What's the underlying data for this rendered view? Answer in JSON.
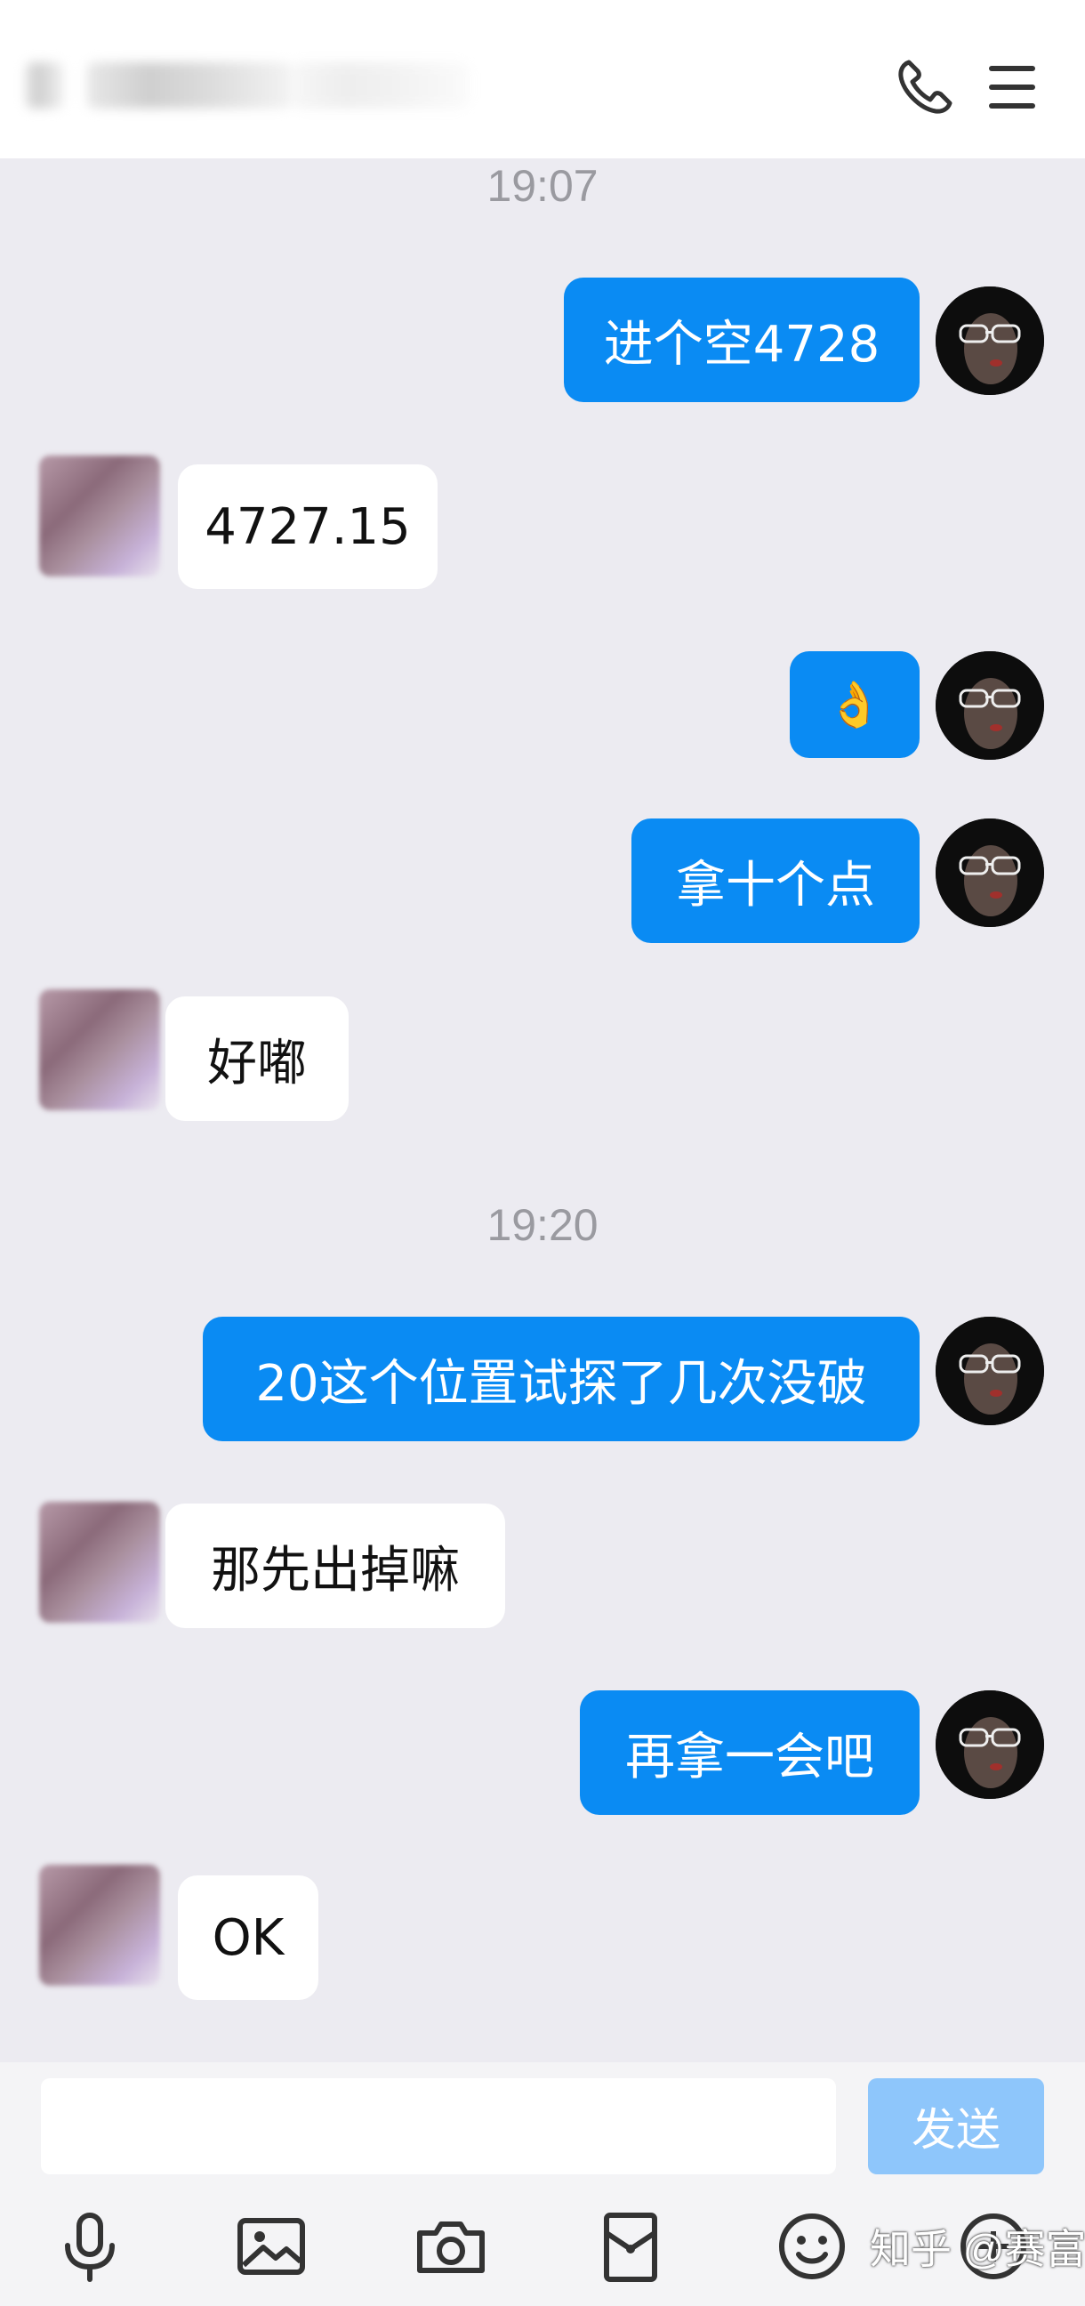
{
  "header": {
    "icons": [
      "phone-icon",
      "menu-icon"
    ]
  },
  "messages": {
    "t1": "19:07",
    "m1": "进个空4728",
    "m2": "4727.15",
    "m3": "👌",
    "m4": "拿十个点",
    "m5": "好嘟",
    "t2": "19:20",
    "m6": "20这个位置试探了几次没破",
    "m7": "那先出掉嘛",
    "m8": "再拿一会吧",
    "m9": "OK"
  },
  "input": {
    "send_label": "发送"
  },
  "toolbar": {
    "icons": [
      "microphone-icon",
      "image-icon",
      "camera-icon",
      "red-packet-icon",
      "emoji-icon",
      "plus-icon"
    ]
  },
  "watermark": "知乎 @赛富贵"
}
